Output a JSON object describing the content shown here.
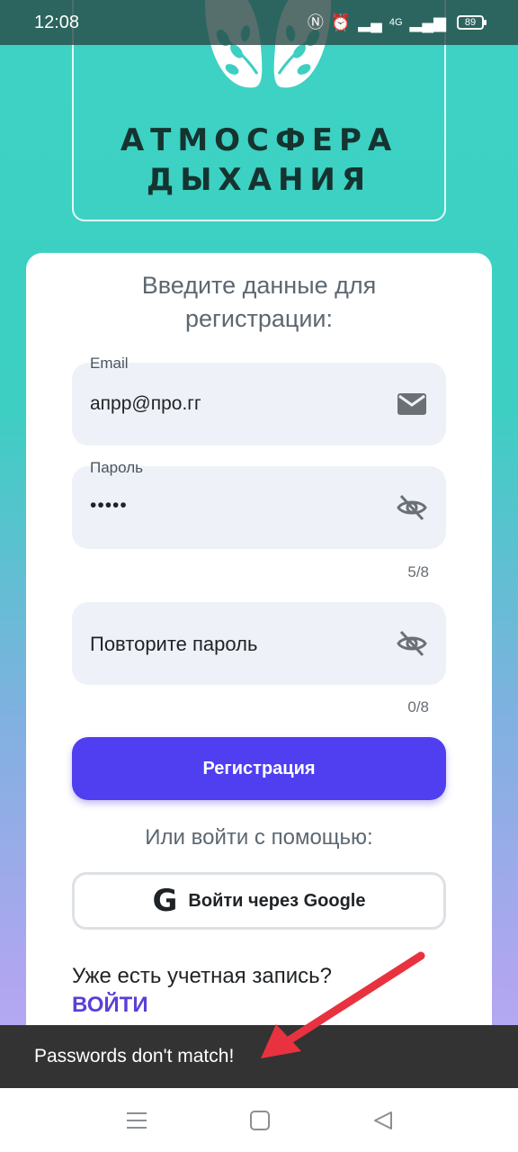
{
  "status_bar": {
    "time": "12:08",
    "battery": "89",
    "network": "4G"
  },
  "logo": {
    "line1": "АТМОСФЕРА",
    "line2": "ДЫХАНИЯ"
  },
  "form": {
    "heading_line1": "Введите данные для",
    "heading_line2": "регистрации:",
    "email": {
      "label": "Email",
      "value": "апрр@про.гг"
    },
    "password": {
      "label": "Пароль",
      "value": "•••••",
      "counter": "5/8"
    },
    "repeat_password": {
      "placeholder": "Повторите пароль",
      "counter": "0/8"
    },
    "register_label": "Регистрация",
    "or_text": "Или войти с помощью:",
    "google_label": "Войти через Google",
    "account_text": "Уже есть учетная запись?",
    "login_label": "ВОЙТИ"
  },
  "snackbar": {
    "message": "Passwords don't match!"
  },
  "colors": {
    "accent": "#4f3ff0",
    "link": "#5b3fd6",
    "annotation_arrow": "#e8323f"
  }
}
